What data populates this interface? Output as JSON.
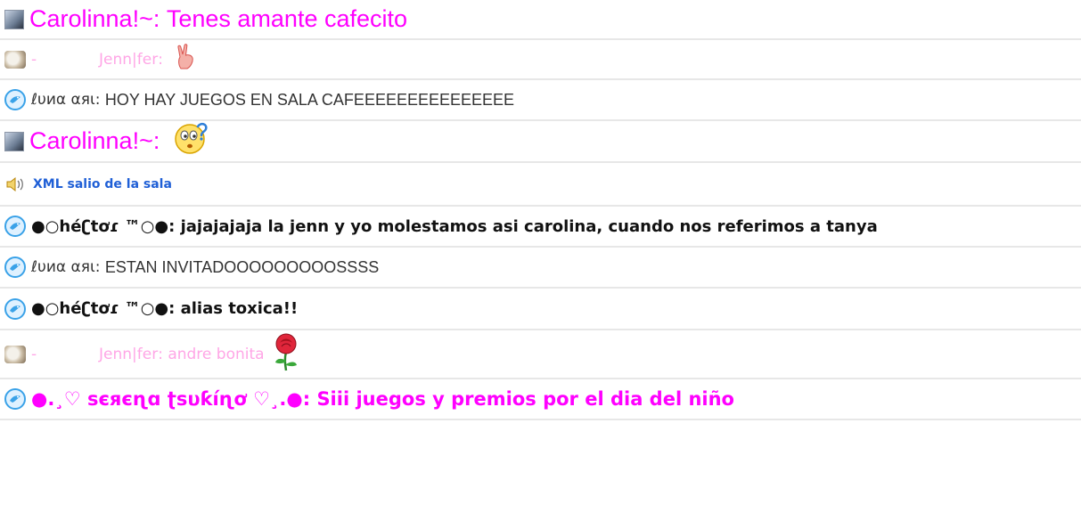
{
  "messages": [
    {
      "style": "big-pink",
      "avatar": "photo-avatar",
      "name": "Carolinna!~",
      "sep": ": ",
      "text": "Tenes amante cafecito",
      "emoji": ""
    },
    {
      "style": "light-pink",
      "avatar": "dog-avatar",
      "prefix": "-",
      "name": "Jenn|fer",
      "sep": ": ",
      "text": "",
      "emoji": "peace-hand-emoji"
    },
    {
      "style": "plain",
      "avatar": "bird-avatar",
      "name": "ℓυиα αяι",
      "sep": ": ",
      "text": "HOY HAY JUEGOS EN SALA CAFEEEEEEEEEEEEEEE",
      "emoji": ""
    },
    {
      "style": "big-pink",
      "avatar": "photo-avatar",
      "name": "Carolinna!~",
      "sep": ": ",
      "text": "",
      "emoji": "confused-face-emoji"
    },
    {
      "style": "system",
      "avatar": "speaker-icon",
      "name": "",
      "sep": "",
      "text": "XML salio de la sala",
      "emoji": ""
    },
    {
      "style": "bold-black",
      "avatar": "bird-avatar",
      "name": "●○héʗtơɾ ™○●",
      "sep": ": ",
      "text": "jajajajaja la jenn y yo molestamos asi carolina, cuando nos referimos a tanya",
      "emoji": ""
    },
    {
      "style": "plain",
      "avatar": "bird-avatar",
      "name": "ℓυиα αяι",
      "sep": ": ",
      "text": "ESTAN INVITADOOOOOOOOOSSSS",
      "emoji": ""
    },
    {
      "style": "bold-black",
      "avatar": "bird-avatar",
      "name": "●○héʗtơɾ ™○●",
      "sep": ": ",
      "text": "alias toxica!!",
      "emoji": ""
    },
    {
      "style": "light-pink",
      "avatar": "dog-avatar",
      "prefix": "-",
      "name": "Jenn|fer",
      "sep": ": ",
      "text": "andre bonita",
      "emoji": "rose-emoji"
    },
    {
      "style": "bold-pink",
      "avatar": "bird-avatar",
      "name": "●.¸♡ ꜱєяєɳɑ ʈꜱυƙíɳơ ♡¸.●",
      "sep": ": ",
      "text": "Siii juegos y premios por el dia del niño",
      "emoji": ""
    }
  ],
  "colors": {
    "pink": "#ff00ff",
    "light_pink": "#ffa6e6",
    "system_blue": "#1f5fd6",
    "row_border": "#e7e7e7"
  }
}
